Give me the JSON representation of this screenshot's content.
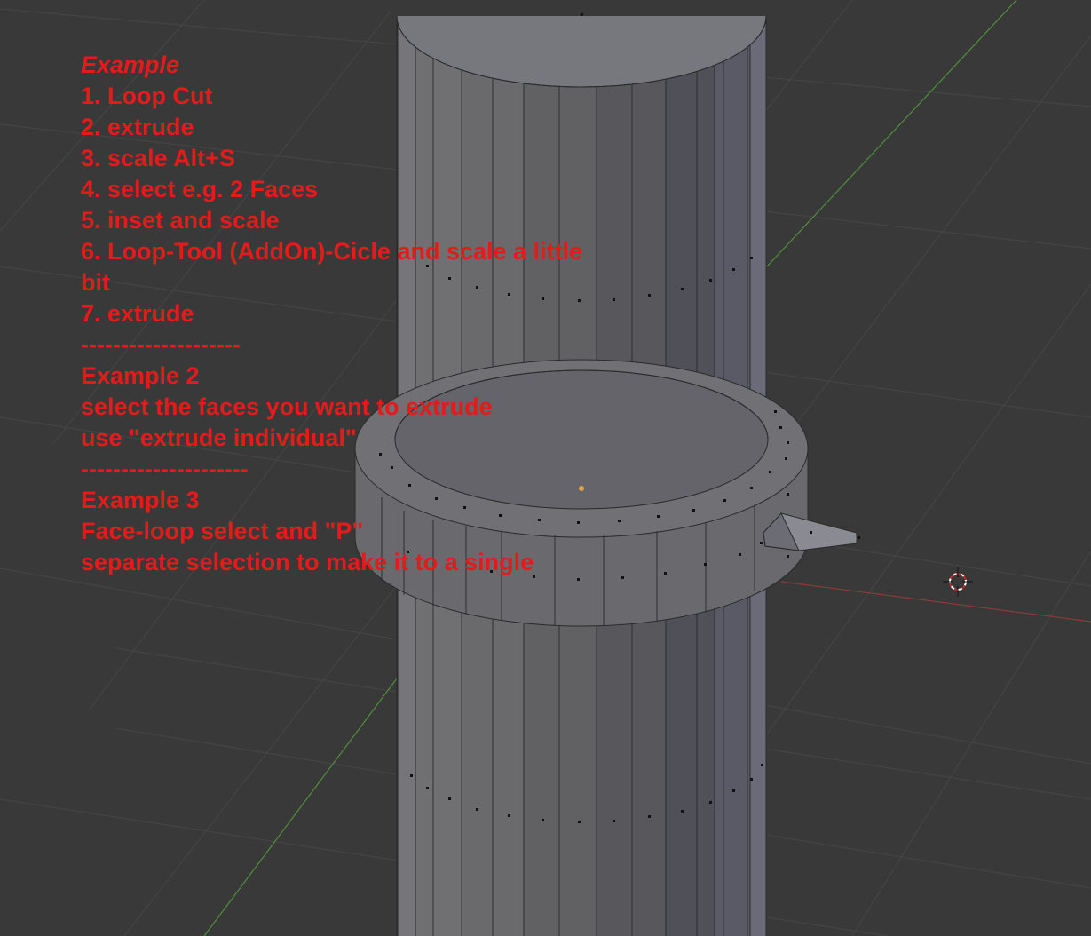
{
  "viewport": {
    "background_color": "#393939",
    "grid_color": "#4a4a4a",
    "axis_y_color": "#4e9a3a",
    "axis_x_color": "#9a3a3a",
    "mesh_face_color": "#6b6b6e",
    "mesh_cap_color": "#77777d",
    "text_color": "#e31b1b"
  },
  "notes": {
    "example1_title": "Example",
    "example1_steps": [
      "1. Loop Cut",
      "2. extrude",
      "3. scale Alt+S",
      "4. select e.g. 2 Faces",
      "5. inset and scale",
      "6. Loop-Tool (AddOn)-Cicle and scale a little",
      "bit",
      "7. extrude"
    ],
    "separator1": "--------------------",
    "example2_title": "Example 2",
    "example2_lines": [
      "select the faces you want to extrude",
      "use \"extrude individual\""
    ],
    "separator2": "---------------------",
    "example3_title": "Example 3",
    "example3_lines": [
      "Face-loop select and \"P\"",
      "separate selection to make it to a single"
    ]
  },
  "icons": {
    "cursor": "3d-cursor-icon",
    "origin": "object-origin-icon"
  }
}
